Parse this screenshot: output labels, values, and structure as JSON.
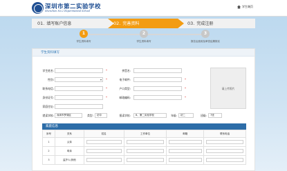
{
  "header": {
    "school_name_cn": "深圳市第二实验学校",
    "school_name_en": "Shenzhen No.2 Experimental School",
    "home_link": "学生端页"
  },
  "steps": [
    {
      "num": "01.",
      "label": "填写账户信息"
    },
    {
      "num": "02.",
      "label": "完善资料"
    },
    {
      "num": "03.",
      "label": "完成注册"
    }
  ],
  "progress": [
    {
      "num": "1",
      "label": "学生资料填写"
    },
    {
      "num": "2",
      "label": "学生资料填写"
    },
    {
      "num": "3",
      "label": "报名后费用及审查结果核实"
    }
  ],
  "form": {
    "title": "学生资料填写",
    "fields": {
      "student_name": "学生姓名:",
      "gender": "性别:",
      "contact_phone": "联系电话:",
      "id_number": "身份证号:",
      "home_address": "家庭住址:",
      "pinyin_name": "拼音名:",
      "email": "电子邮件:",
      "hukou_type": "户口类型:",
      "postal_code": "邮政编码:"
    },
    "required_mark": "*",
    "photo_label": "请上传照片",
    "school_row": {
      "graduated_school_label": "就读学校:",
      "graduated_school_value": "深圳市罗湖区",
      "type_label": "类型:",
      "type_value": "初中",
      "applied_school_label": "报读学校:",
      "applied_school_value": "B、第二实验学校",
      "grade_label": "年级:",
      "grade_value": "初二",
      "class_label": "班级:",
      "class_value": "7班"
    }
  },
  "family": {
    "title": "家庭信息",
    "columns": [
      "序号",
      "关系",
      "姓名",
      "工作单位",
      "邮箱",
      "联系电话"
    ],
    "rows": [
      {
        "index": "1",
        "relation": "父亲"
      },
      {
        "index": "2",
        "relation": "母亲"
      },
      {
        "index": "3",
        "relation": "监护人/其他"
      }
    ]
  }
}
